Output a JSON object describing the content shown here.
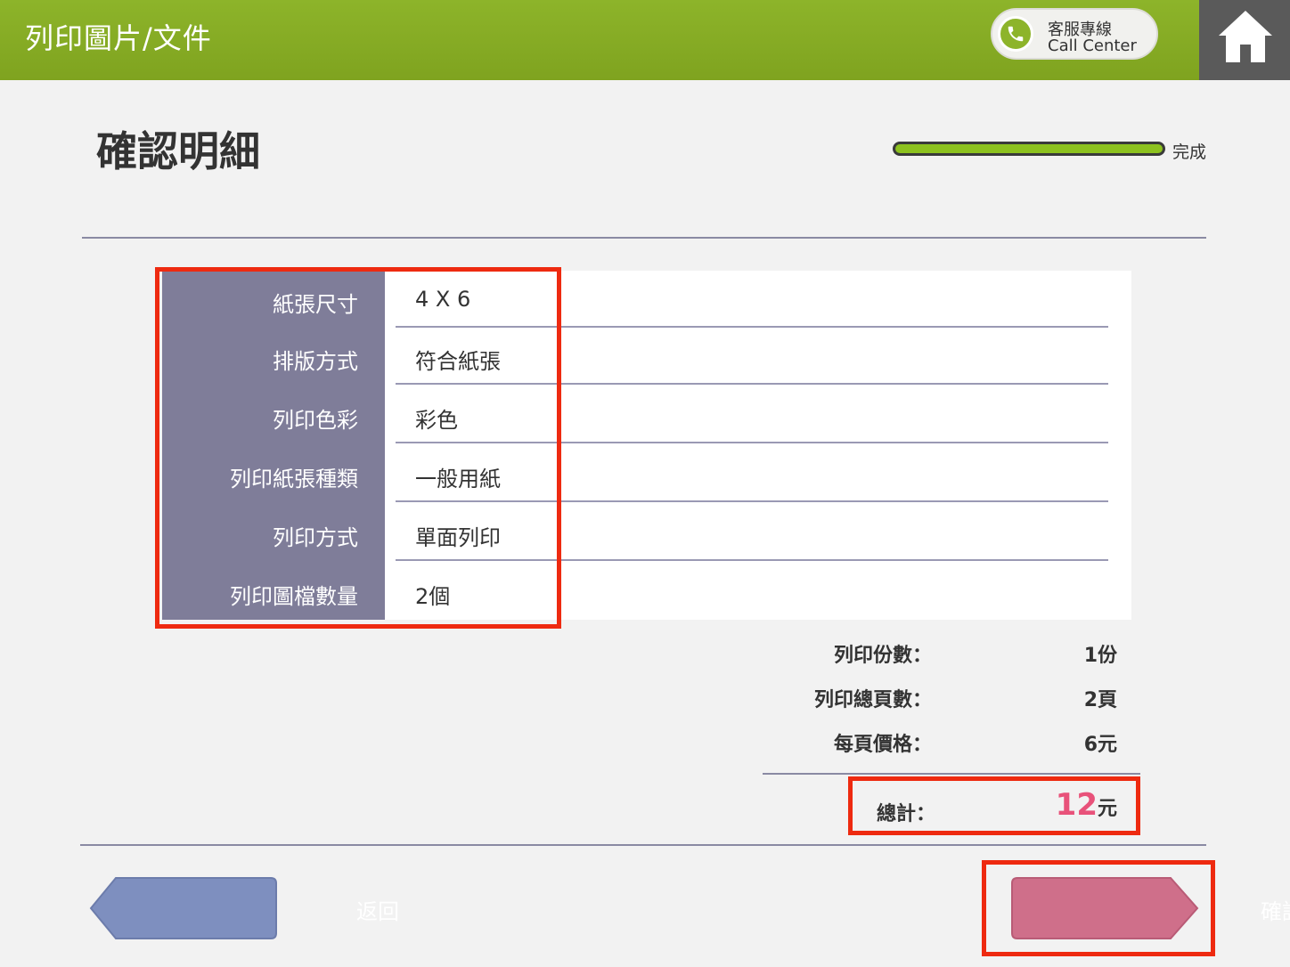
{
  "header": {
    "title": "列印圖片/文件",
    "call_center": {
      "line1": "客服專線",
      "line2": "Call Center",
      "icon": "phone-icon"
    },
    "home_icon": "home-icon",
    "colors": {
      "bar": "#8db42a",
      "home_bg": "#5a5a5a"
    }
  },
  "page": {
    "title": "確認明細",
    "progress": {
      "label": "完成",
      "percent": 100
    }
  },
  "details": {
    "rows": [
      {
        "label": "紙張尺寸",
        "value": "4 X 6"
      },
      {
        "label": "排版方式",
        "value": "符合紙張"
      },
      {
        "label": "列印色彩",
        "value": "彩色"
      },
      {
        "label": "列印紙張種類",
        "value": "一般用紙"
      },
      {
        "label": "列印方式",
        "value": "單面列印"
      },
      {
        "label": "列印圖檔數量",
        "value": "2個"
      }
    ]
  },
  "summary": {
    "copies_label": "列印份數：",
    "copies_value": "1份",
    "pages_label": "列印總頁數：",
    "pages_value": "2頁",
    "price_label": "每頁價格：",
    "price_value": "6元",
    "total_label": "總計：",
    "total_amount": "12",
    "total_unit": "元",
    "total_color": "#e8527a"
  },
  "buttons": {
    "back_label": "返回",
    "back_color": "#7e8fbf",
    "confirm_label": "確認",
    "confirm_color": "#cf6f8a"
  }
}
